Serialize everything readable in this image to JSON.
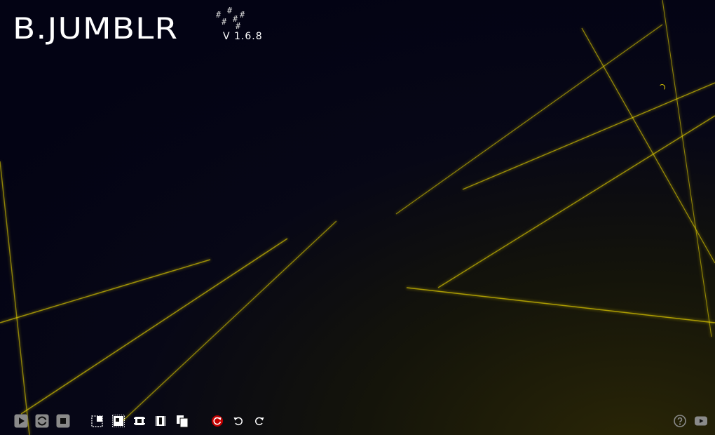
{
  "app": {
    "title": "B.JUMBLR",
    "version": "V 1.6.8",
    "hash_marks": [
      "#",
      "#",
      "#",
      "#",
      "#",
      "#"
    ]
  },
  "status": {
    "loading": true
  },
  "toolbar": {
    "playback": [
      {
        "name": "play-icon",
        "label": "Play"
      },
      {
        "name": "loop-icon",
        "label": "Loop"
      },
      {
        "name": "stop-icon",
        "label": "Stop"
      }
    ],
    "layout": [
      {
        "name": "layout-split-icon"
      },
      {
        "name": "layout-frame-icon"
      },
      {
        "name": "layout-grid-icon"
      },
      {
        "name": "layout-columns-icon"
      },
      {
        "name": "copy-icon"
      }
    ],
    "history": [
      {
        "name": "reset-icon"
      },
      {
        "name": "undo-icon"
      },
      {
        "name": "redo-icon"
      }
    ],
    "right": [
      {
        "name": "help-icon"
      },
      {
        "name": "video-icon"
      }
    ]
  },
  "colors": {
    "background_top": "#030314",
    "background_bottom": "#2a2606",
    "ray": "#e8d300",
    "icon_gray": "#8a8a8a",
    "icon_white": "#ffffff",
    "reset_red": "#c40000"
  }
}
